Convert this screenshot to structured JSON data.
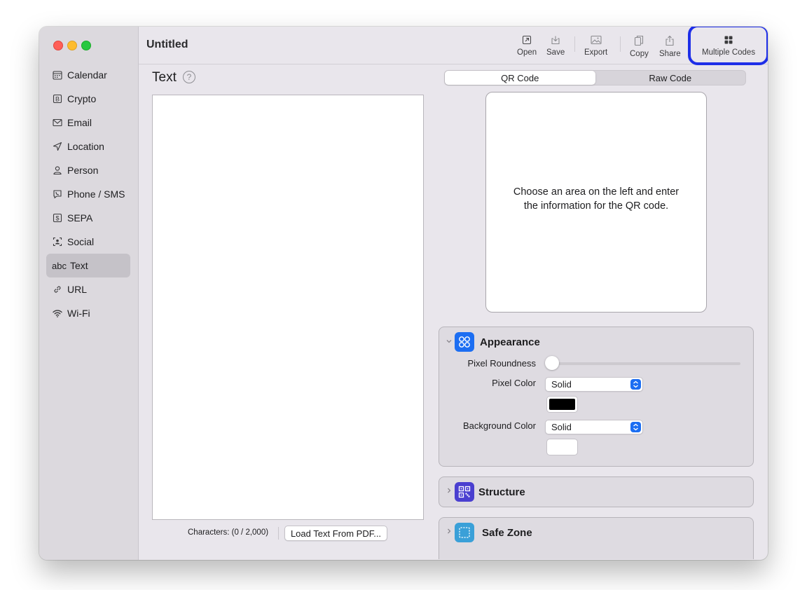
{
  "window": {
    "title": "Untitled"
  },
  "sidebar": {
    "items": [
      {
        "label": "Calendar",
        "icon": "calendar-icon"
      },
      {
        "label": "Crypto",
        "icon": "bitcoin-icon"
      },
      {
        "label": "Email",
        "icon": "envelope-icon"
      },
      {
        "label": "Location",
        "icon": "location-arrow-icon"
      },
      {
        "label": "Person",
        "icon": "person-icon"
      },
      {
        "label": "Phone / SMS",
        "icon": "phone-bubble-icon"
      },
      {
        "label": "SEPA",
        "icon": "dollar-box-icon"
      },
      {
        "label": "Social",
        "icon": "social-person-icon"
      },
      {
        "label": "Text",
        "icon_text": "abc",
        "selected": true
      },
      {
        "label": "URL",
        "icon": "link-icon"
      },
      {
        "label": "Wi-Fi",
        "icon": "wifi-icon"
      }
    ]
  },
  "toolbar": {
    "open": "Open",
    "save": "Save",
    "export": "Export",
    "copy": "Copy",
    "share": "Share",
    "multiple_codes": "Multiple Codes"
  },
  "editor": {
    "heading": "Text",
    "help": "?",
    "characters": "Characters: (0 / 2,000)",
    "load_pdf": "Load Text From PDF..."
  },
  "preview": {
    "tabs": [
      {
        "label": "QR Code",
        "selected": true
      },
      {
        "label": "Raw Code",
        "selected": false
      }
    ],
    "message": "Choose an area on the left and enter the information for the QR code."
  },
  "appearance": {
    "title": "Appearance",
    "pixel_roundness_label": "Pixel Roundness",
    "pixel_roundness_value": 0,
    "pixel_color_label": "Pixel Color",
    "pixel_color_value": "Solid",
    "pixel_color_swatch": "#000000",
    "background_color_label": "Background Color",
    "background_color_value": "Solid",
    "background_color_swatch": "#ffffff"
  },
  "structure": {
    "title": "Structure"
  },
  "safe_zone": {
    "title": "Safe Zone"
  },
  "colors": {
    "accent": "#1c6ef2",
    "highlight": "#1e2ee8",
    "appearance_icon": "#1c6ef2",
    "structure_icon": "#4a3fd0",
    "safe_zone_icon": "#3aa0d8"
  }
}
